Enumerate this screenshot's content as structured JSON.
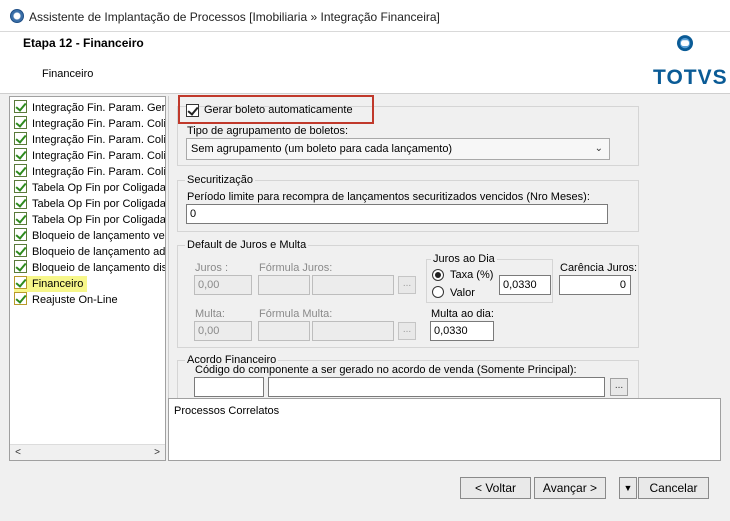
{
  "window": {
    "title": "Assistente de Implantação de Processos [Imobiliaria » Integração Financeira]"
  },
  "header": {
    "step_title": "Etapa 12 - Financeiro",
    "step_subtitle": "Financeiro",
    "logo_text": "TOTVS",
    "logo_color": "#0a5b96"
  },
  "tree": {
    "items": [
      {
        "label": "Integração Fin. Param. Gera",
        "icon": "checkbox-done-icon"
      },
      {
        "label": "Integração Fin. Param. Colig",
        "icon": "checkbox-done-icon"
      },
      {
        "label": "Integração Fin. Param. Colig",
        "icon": "checkbox-done-icon"
      },
      {
        "label": "Integração Fin. Param. Colig",
        "icon": "checkbox-done-icon"
      },
      {
        "label": "Integração Fin. Param. Colig",
        "icon": "checkbox-done-icon"
      },
      {
        "label": "Tabela Op Fin por Coligada",
        "icon": "checkbox-done-icon"
      },
      {
        "label": "Tabela Op Fin por Coligada",
        "icon": "checkbox-done-icon"
      },
      {
        "label": "Tabela Op Fin por Coligada",
        "icon": "checkbox-done-icon"
      },
      {
        "label": "Bloqueio de lançamento ven",
        "icon": "checkbox-done-icon"
      },
      {
        "label": "Bloqueio de lançamento adit",
        "icon": "checkbox-done-icon"
      },
      {
        "label": "Bloqueio de lançamento dist",
        "icon": "checkbox-done-icon"
      },
      {
        "label": "Financeiro",
        "icon": "checkbox-pending-icon",
        "active": true
      },
      {
        "label": "Reajuste On-Line",
        "icon": "checkbox-pending-icon"
      }
    ],
    "scroll_left": "<",
    "scroll_right": ">",
    "active_highlight_color": "#f7f78a"
  },
  "form": {
    "gerar_boleto_label": "Gerar boleto automaticamente",
    "gerar_boleto_checked": true,
    "tipo_agrupamento_label": "Tipo de agrupamento de boletos:",
    "tipo_agrupamento_value": "Sem agrupamento (um boleto para cada lançamento)",
    "securitizacao": {
      "group_label": "Securitização",
      "periodo_label": "Período limite para recompra de lançamentos securitizados vencidos (Nro Meses):",
      "periodo_value": "0"
    },
    "juros_multa": {
      "group_label": "Default de Juros e Multa",
      "juros_label": "Juros :",
      "juros_value": "0,00",
      "formula_juros_label": "Fórmula Juros:",
      "multa_label": "Multa:",
      "multa_value": "0,00",
      "formula_multa_label": "Fórmula Multa:",
      "juros_dia": {
        "group_label": "Juros ao Dia",
        "taxa_label": "Taxa (%)",
        "valor_label": "Valor",
        "selected": "taxa",
        "taxa_value": "0,0330"
      },
      "carencia_label": "Carência Juros:",
      "carencia_value": "0",
      "multa_dia_label": "Multa ao dia:",
      "multa_dia_value": "0,0330"
    },
    "acordo": {
      "group_label": "Acordo Financeiro",
      "codigo_label": "Código do componente a ser gerado no acordo de venda (Somente Principal):"
    },
    "dots_label": "..."
  },
  "related": {
    "label": "Processos Correlatos"
  },
  "footer": {
    "voltar_label": "< Voltar",
    "avancar_label": "Avançar >",
    "cancelar_label": "Cancelar",
    "dropdown_label": "▼"
  },
  "colors": {
    "highlight_border": "#c0392b"
  }
}
